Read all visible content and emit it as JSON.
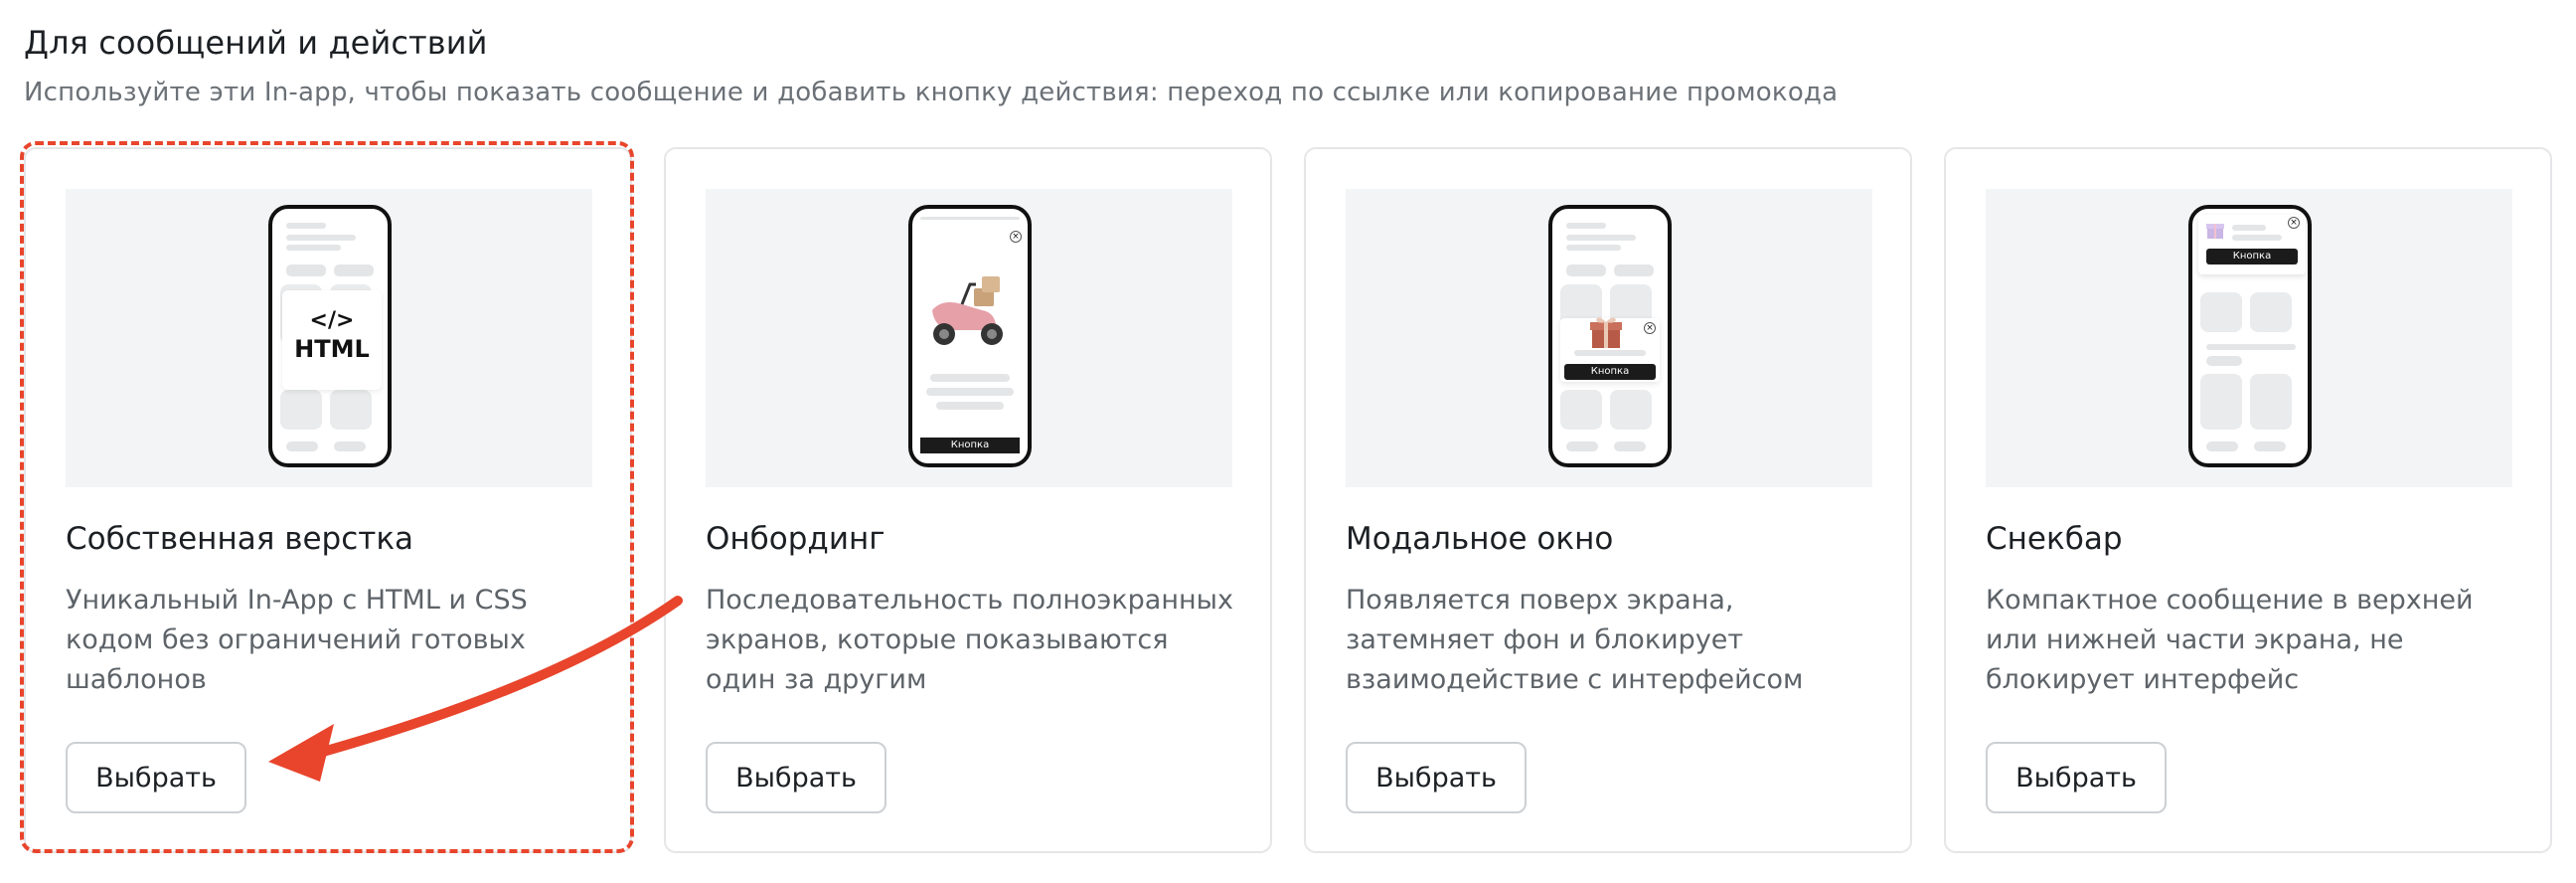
{
  "section": {
    "title": "Для сообщений и действий",
    "subtitle": "Используйте эти In-app, чтобы показать сообщение и добавить кнопку действия: переход по ссылке или копирование промокода"
  },
  "cards": [
    {
      "title": "Собственная верстка",
      "description": "Уникальный In-App с HTML и CSS кодом без ограничений готовых шаблонов",
      "button_label": "Выбрать",
      "preview": {
        "code_label": "</>",
        "html_label": "HTML"
      },
      "highlighted": true
    },
    {
      "title": "Онбординг",
      "description": "Последовательность полноэкранных экранов, которые показываются один за другим",
      "button_label": "Выбрать",
      "preview": {
        "button_text": "Кнопка",
        "image": "scooter-icon"
      }
    },
    {
      "title": "Модальное окно",
      "description": "Появляется поверх экрана, затемняет фон и блокирует взаимодействие с интерфейсом",
      "button_label": "Выбрать",
      "preview": {
        "button_text": "Кнопка",
        "image": "gift-icon"
      }
    },
    {
      "title": "Снекбар",
      "description": "Компактное сообщение в верхней или нижней части экрана, не блокирует интерфейс",
      "button_label": "Выбрать",
      "preview": {
        "button_text": "Кнопка",
        "image": "gift-icon"
      }
    }
  ],
  "colors": {
    "highlight": "#e8452c",
    "border": "#e4e6e8",
    "preview_bg": "#f2f4f5"
  }
}
